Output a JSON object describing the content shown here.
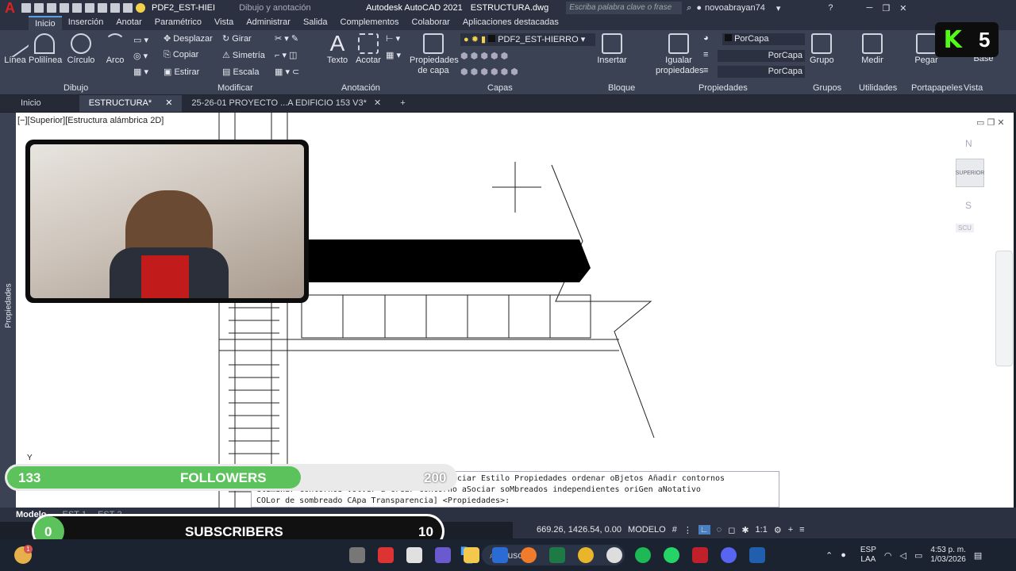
{
  "titlebar": {
    "layer_combo": "PDF2_EST-HIEI",
    "workspace": "Dibujo y anotación",
    "app_title": "Autodesk AutoCAD 2021",
    "file_title": "ESTRUCTURA.dwg",
    "search_placeholder": "Escriba palabra clave o frase",
    "user": "novoabrayan74"
  },
  "ribbon_tabs": [
    "Inicio",
    "Inserción",
    "Anotar",
    "Paramétrico",
    "Vista",
    "Administrar",
    "Salida",
    "Complementos",
    "Colaborar",
    "Aplicaciones destacadas"
  ],
  "ribbon": {
    "draw": {
      "linea": "Línea",
      "polilinea": "Polilínea",
      "circulo": "Círculo",
      "arco": "Arco",
      "panel": "Dibujo"
    },
    "modify": {
      "desplazar": "Desplazar",
      "girar": "Girar",
      "copiar": "Copiar",
      "simetria": "Simetría",
      "estirar": "Estirar",
      "escala": "Escala",
      "panel": "Modificar"
    },
    "annotation": {
      "texto": "Texto",
      "acotar": "Acotar",
      "panel": "Anotación"
    },
    "layers": {
      "props": "Propiedades de capa",
      "current": "PDF2_EST-HIERRO",
      "panel": "Capas"
    },
    "block": {
      "insertar": "Insertar",
      "panel": "Bloque"
    },
    "properties": {
      "igualar": "Igualar propiedades",
      "porcapa1": "PorCapa",
      "porcapa2": "PorCapa",
      "porcapa3": "PorCapa",
      "panel": "Propiedades"
    },
    "groups": {
      "grupo": "Grupo",
      "panel": "Grupos"
    },
    "utilities": {
      "medir": "Medir",
      "panel": "Utilidades"
    },
    "clipboard": {
      "pegar": "Pegar",
      "panel": "Portapapeles"
    },
    "view": {
      "base": "Base",
      "panel": "Vista"
    }
  },
  "doc_tabs": [
    "Inicio",
    "ESTRUCTURA*",
    "25-26-01 PROYECTO ...A EDIFICIO 153 V3*"
  ],
  "viewport_label": "[−][Superior][Estructura alámbrica 2D]",
  "left_panel": "Propiedades",
  "viewcube": {
    "n": "N",
    "s": "S",
    "top": "SUPERIOR",
    "ucs": "SCU"
  },
  "command": {
    "line1": "EDITSOMB Indique opción de sombreado [Disociar Estilo Propiedades ordenar oBjetos Añadir contornos",
    "line2": "eliminar Contornos vOlver a crear contorno aSociar soMbreados independientes oriGen aNotativo",
    "line3": "COLor de sombreado CApa Transparencia] <Propiedades>:"
  },
  "model_tabs": [
    "Modelo",
    "EST-1",
    "EST-2"
  ],
  "status": {
    "coords": "669.26, 1426.54, 0.00",
    "mode": "MODELO",
    "scale": "1:1"
  },
  "overlay": {
    "followers_count": "133",
    "followers_label": "FOLLOWERS",
    "followers_goal": "200",
    "subs_count": "0",
    "subs_label": "SUBSCRIBERS",
    "subs_goal": "10",
    "badge": "5"
  },
  "taskbar": {
    "search": "Buscar",
    "lang1": "ESP",
    "lang2": "LAA",
    "time": "4:53 p. m.",
    "date": "1/03/2026",
    "notif": "1"
  }
}
